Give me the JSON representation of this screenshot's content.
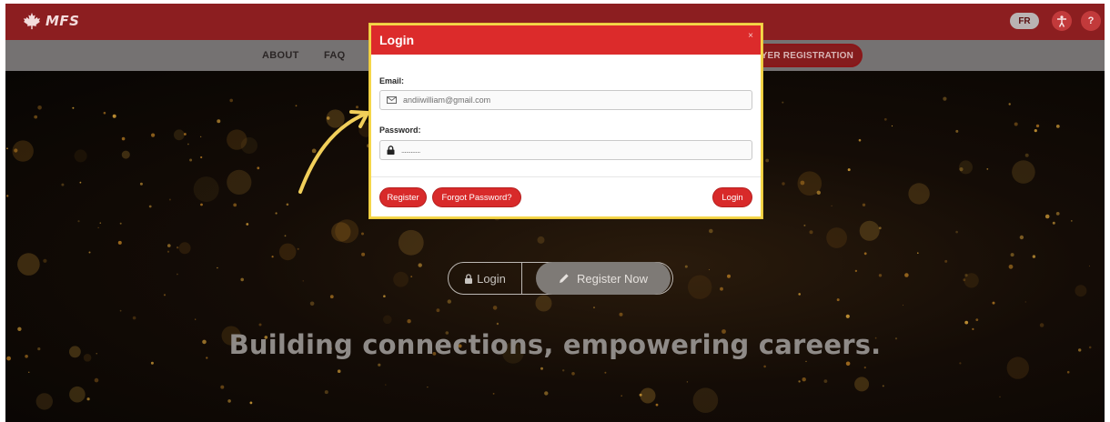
{
  "topbar": {
    "logo_text": "MFS",
    "lang_button": "FR",
    "accessibility_icon": "accessibility-icon",
    "help_label": "?"
  },
  "nav": {
    "items": [
      "ABOUT",
      "FAQ"
    ],
    "employer_registration": "YER REGISTRATION"
  },
  "hero": {
    "login_label": "Login",
    "register_label": "Register Now",
    "headline": "Building connections, empowering careers."
  },
  "modal": {
    "title": "Login",
    "close_label": "×",
    "email_label": "Email:",
    "email_value": "andiiwilliam@gmail.com",
    "password_label": "Password:",
    "password_value": "............",
    "register_button": "Register",
    "forgot_button": "Forgot Password?",
    "login_button": "Login"
  },
  "colors": {
    "brand_red": "#dc2b2b",
    "topbar_red": "#8c1e20",
    "highlight_yellow": "#f5d64a"
  }
}
